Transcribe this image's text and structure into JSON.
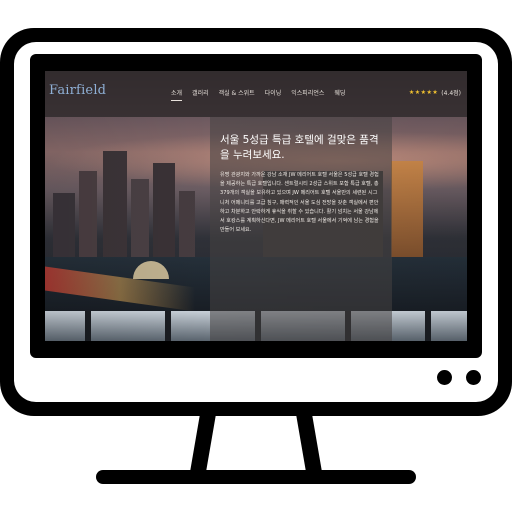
{
  "site": {
    "logo": "Fairfield"
  },
  "nav": {
    "items": [
      {
        "label": "소개",
        "active": true
      },
      {
        "label": "갤러리",
        "active": false
      },
      {
        "label": "객실 & 스위트",
        "active": false
      },
      {
        "label": "다이닝",
        "active": false
      },
      {
        "label": "익스피리언스",
        "active": false
      },
      {
        "label": "웨딩",
        "active": false
      }
    ]
  },
  "rating": {
    "stars": "★★★★★",
    "value": "(4.4점)",
    "score": 4.4
  },
  "hero": {
    "headline": "서울 5성급 특급 호텔에 걸맞은 품격을 누려보세요.",
    "body": "유명 관광지와 가까운 강남 소재 JW 메리어트 호텔 서울은 5성급 호텔 경험을 제공하는 특급 호텔입니다. 센트럴시티 2성급 스위트 포함 특급 호텔, 총 379개의 객실을 보유하고 있으며 JW 메리어트 호텔 서울만의 세련된 시그니처 어메니티를 고급 침구, 매력적인 서울 도심 전망을 갖춘 객실에서 편안하고 차분하고 안락하게 휴식을 취할 수 있습니다. 활기 넘치는 서울 강남에서 호캉스를 계획하신다면, JW 메리어트 호텔 서울에서 기억에 남는 경험을 만들어 보세요."
  },
  "colors": {
    "logo": "#8fb0d6",
    "star": "#f2c230",
    "monitor_frame": "#000000"
  }
}
